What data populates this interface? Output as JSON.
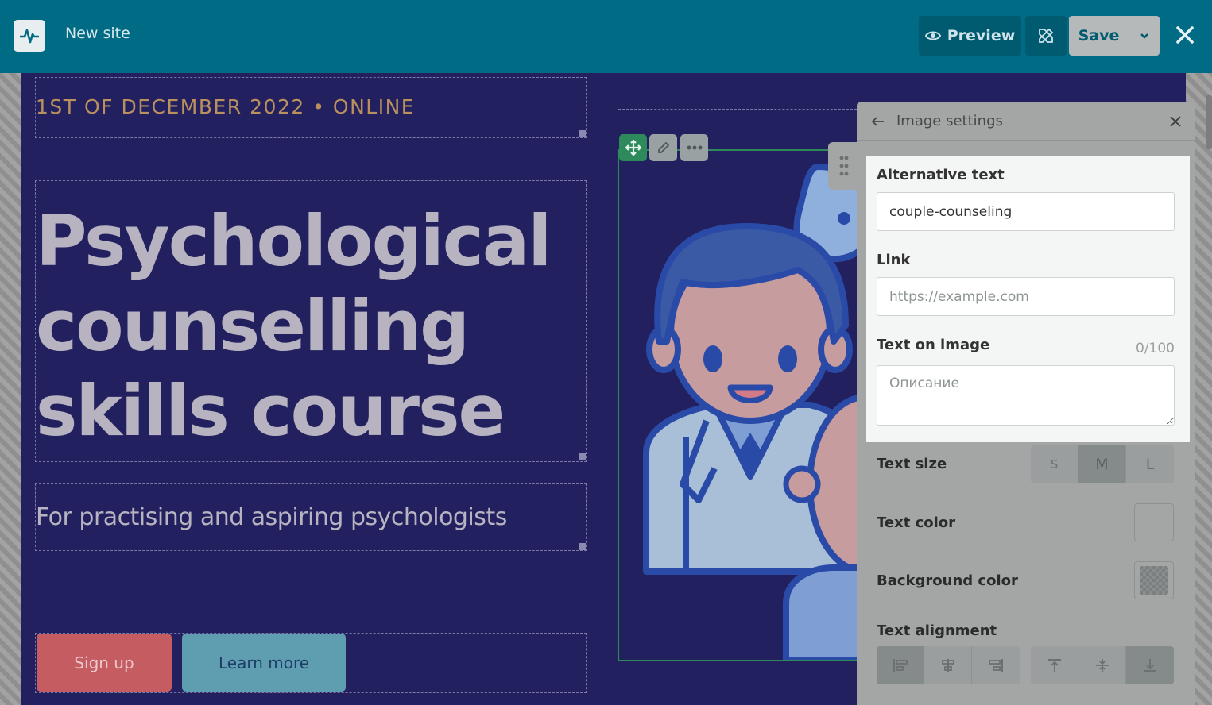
{
  "topbar": {
    "site_name": "New site",
    "preview_label": "Preview",
    "save_label": "Save"
  },
  "page": {
    "date_line": "1ST OF DECEMBER 2022 • ONLINE",
    "headline": "Psychological counselling skills course",
    "subtitle": "For practising and aspiring psychologists",
    "signup_label": "Sign up",
    "learn_more_label": "Learn more"
  },
  "panel": {
    "title": "Image settings",
    "alt_text_label": "Alternative text",
    "alt_text_value": "couple-counseling",
    "link_label": "Link",
    "link_placeholder": "https://example.com",
    "text_on_image_label": "Text on image",
    "text_on_image_counter": "0/100",
    "text_on_image_placeholder": "Описание",
    "text_size_label": "Text size",
    "text_size_options": [
      "S",
      "M",
      "L"
    ],
    "text_size_selected": "M",
    "text_color_label": "Text color",
    "background_color_label": "Background color",
    "text_alignment_label": "Text alignment"
  },
  "colors": {
    "topbar": "#006b85",
    "page_background": "#22205e",
    "accent_green": "#2e8a5a",
    "signup_button": "#c55c62",
    "learn_more_button": "#5f9eb0",
    "date_line": "#b9905e"
  },
  "icons": {
    "logo": "pulse-icon",
    "preview": "eye-icon",
    "design": "pencil-ruler-icon",
    "save_more": "chevron-down-icon",
    "close": "close-icon",
    "back": "arrow-left-icon",
    "move": "move-icon",
    "edit": "pencil-icon",
    "more": "ellipsis-icon",
    "drag": "drag-handle-icon"
  }
}
